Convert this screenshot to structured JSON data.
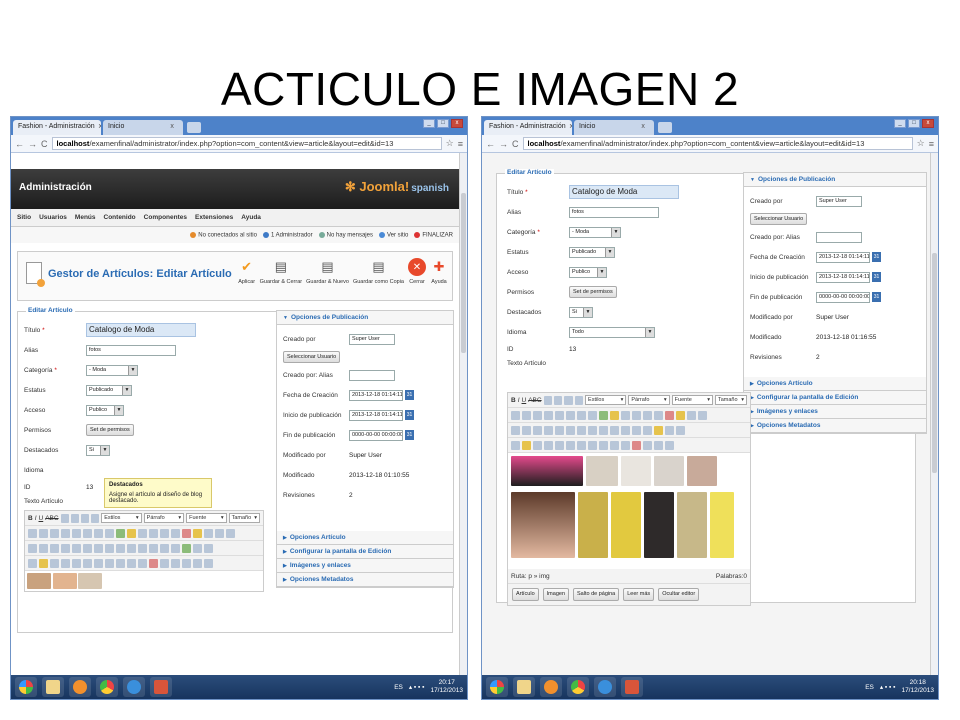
{
  "slide": {
    "title": "ACTICULO E IMAGEN 2"
  },
  "browser": {
    "tab_active": "Fashion - Administración",
    "tab_inactive": "Inicio",
    "tab_close": "x",
    "url_host": "localhost",
    "url_path": "/examenfinal/administrator/index.php?option=com_content&view=article&layout=edit&id=13"
  },
  "admin": {
    "header_title": "Administración",
    "logo": "Joomla!",
    "logo_suffix": "spanish",
    "menu": [
      "Sitio",
      "Usuarios",
      "Menús",
      "Contenido",
      "Componentes",
      "Extensiones",
      "Ayuda"
    ],
    "status": [
      "No conectados al sitio",
      "1 Administrador",
      "No hay mensajes",
      "Ver sitio",
      "FINALIZAR"
    ],
    "page_title": "Gestor de Artículos: Editar Artículo",
    "toolbar": [
      "Aplicar",
      "Guardar & Cerrar",
      "Guardar & Nuevo",
      "Guardar como Copia",
      "Cerrar",
      "Ayuda"
    ]
  },
  "form": {
    "legend": "Editar Artículo",
    "labels": {
      "title": "Título",
      "alias": "Alias",
      "category": "Categoría",
      "status": "Estatus",
      "access": "Acceso",
      "permissions": "Permisos",
      "featured": "Destacados",
      "language": "Idioma",
      "id": "ID",
      "text": "Texto Artículo"
    },
    "values": {
      "title": "Catalogo de Moda",
      "alias": "fotos",
      "category": "- Moda",
      "status": "Publicado",
      "access": "Publico",
      "permissions_button": "Set de permisos",
      "featured": "Si",
      "language": "Todo",
      "id": "13"
    },
    "required_mark": "*"
  },
  "tooltip": {
    "title": "Destacados",
    "body": "Asigne el artículo al diseño de blog destacado."
  },
  "publishing": {
    "header": "Opciones de Publicación",
    "labels": [
      "Creado por",
      "Creado por: Alias",
      "Fecha de Creación",
      "Inicio de publicación",
      "Fin de publicación",
      "Modificado por",
      "Modificado",
      "Revisiones"
    ],
    "created_by": "Super User",
    "select_user_button": "Seleccionar Usuario",
    "created_date": "2013-12-18 01:14:11",
    "publish_up": "2013-12-18 01:14:11",
    "publish_down": "0000-00-00 00:00:00",
    "modified_by": "Super User",
    "modified_left": "2013-12-18 01:10:55",
    "modified_right": "2013-12-18 01:16:55",
    "revisions_left": "2",
    "revisions_right": "2",
    "calendar_label": "31"
  },
  "sections": [
    "Opciones Artículo",
    "Configurar la pantalla de Edición",
    "Imágenes y enlaces",
    "Opciones Metadatos"
  ],
  "editor": {
    "styles": "Estilos",
    "paragraph": "Párrafo",
    "font": "Fuente",
    "size": "Tamaño",
    "path": "Ruta: p » img",
    "words": "Palabras:0",
    "buttons": [
      "Artículo",
      "Imagen",
      "Salto de página",
      "Leer más",
      "Ocultar editor"
    ]
  },
  "taskbar": {
    "lang": "ES",
    "left_time": "20:17",
    "right_time": "20:18",
    "date": "17/12/2013"
  }
}
